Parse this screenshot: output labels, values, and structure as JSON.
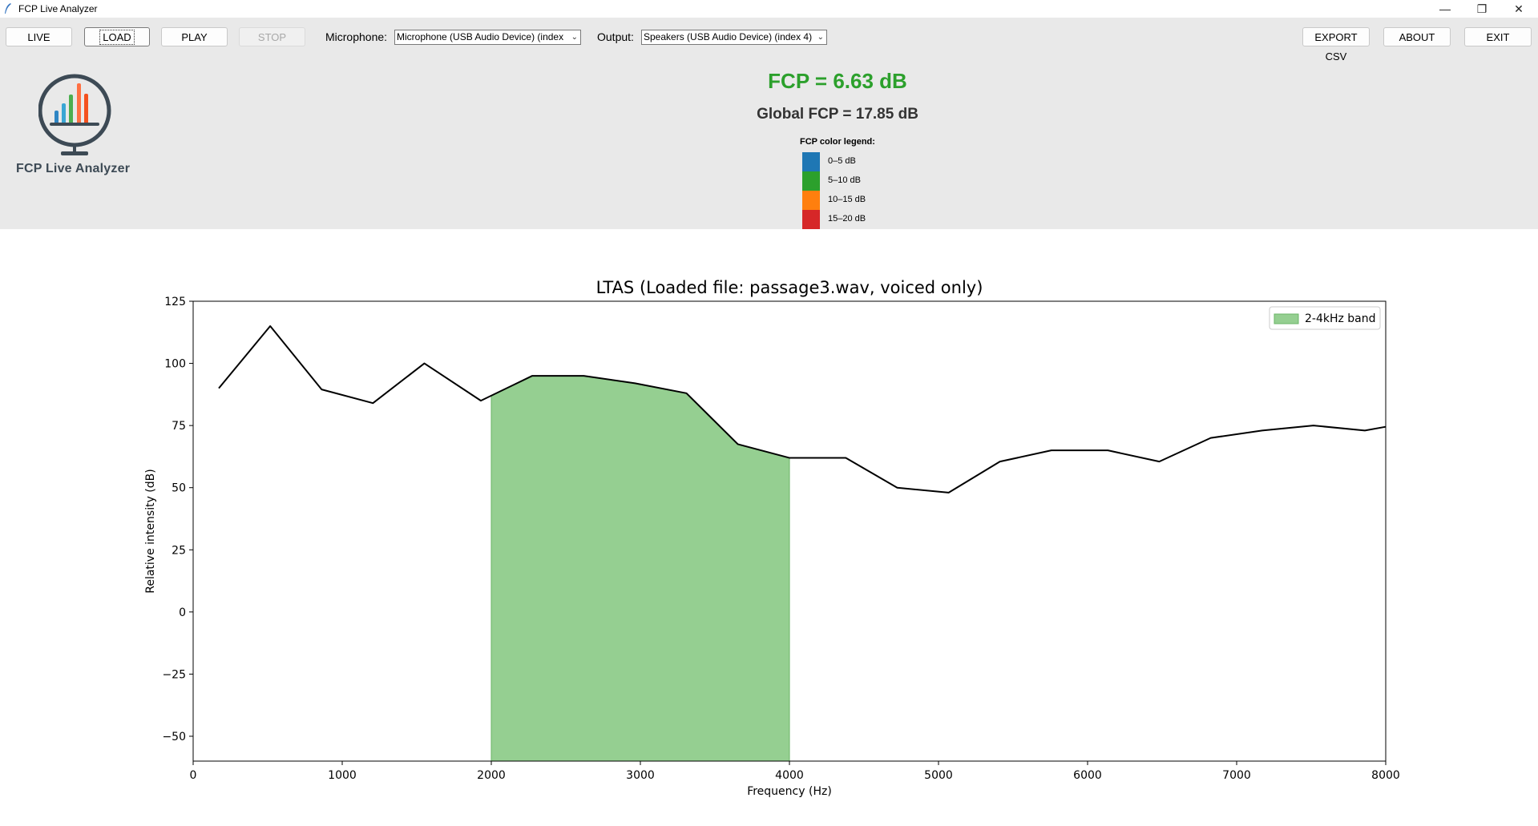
{
  "window": {
    "title": "FCP Live Analyzer"
  },
  "toolbar": {
    "live": "LIVE",
    "load": "LOAD",
    "play": "PLAY",
    "stop": "STOP",
    "mic_label": "Microphone:",
    "mic_value": "Microphone (USB Audio Device) (index",
    "out_label": "Output:",
    "out_value": "Speakers (USB Audio Device) (index 4)",
    "export": "EXPORT CSV",
    "about": "ABOUT",
    "exit": "EXIT"
  },
  "brand": {
    "name": "FCP Live Analyzer"
  },
  "readout": {
    "fcp": "FCP = 6.63 dB",
    "global_fcp": "Global FCP = 17.85 dB"
  },
  "fcp_legend": {
    "title": "FCP color legend:",
    "items": [
      {
        "label": "0–5 dB",
        "color": "#1f77b4"
      },
      {
        "label": "5–10 dB",
        "color": "#2ca02c"
      },
      {
        "label": "10–15 dB",
        "color": "#ff7f0e"
      },
      {
        "label": "15–20 dB",
        "color": "#d62728"
      }
    ]
  },
  "chart_data": {
    "type": "line",
    "title": "LTAS (Loaded file: passage3.wav, voiced only)",
    "xlabel": "Frequency (Hz)",
    "ylabel": "Relative intensity (dB)",
    "xlim": [
      0,
      8000
    ],
    "ylim": [
      -60,
      125
    ],
    "xticks": [
      0,
      1000,
      2000,
      3000,
      4000,
      5000,
      6000,
      7000,
      8000
    ],
    "xtick_labels": [
      "0",
      "1000",
      "2000",
      "3000",
      "4000",
      "5000",
      "6000",
      "7000",
      "8000"
    ],
    "yticks": [
      125,
      100,
      75,
      50,
      25,
      0,
      -25,
      -50
    ],
    "ytick_labels": [
      "125",
      "100",
      "75",
      "50",
      "25",
      "0",
      "−25",
      "−50"
    ],
    "line_color": "#000000",
    "x": [
      172,
      517,
      862,
      1206,
      1551,
      1930,
      2275,
      2620,
      2964,
      3309,
      3654,
      3999,
      4378,
      4723,
      5068,
      5412,
      5757,
      6136,
      6481,
      6826,
      7171,
      7515,
      7860,
      8000
    ],
    "y": [
      90,
      115,
      89.5,
      84,
      100,
      85,
      95,
      95,
      92,
      88,
      67.5,
      62,
      62,
      50,
      48,
      60.5,
      65,
      65,
      60.5,
      70,
      73,
      75,
      73,
      74.5
    ],
    "band": {
      "label": "2-4kHz band",
      "x0": 2000,
      "x1": 4000,
      "color": "#95cf91",
      "edge": "#6ab466"
    },
    "legend_position": "upper right"
  }
}
